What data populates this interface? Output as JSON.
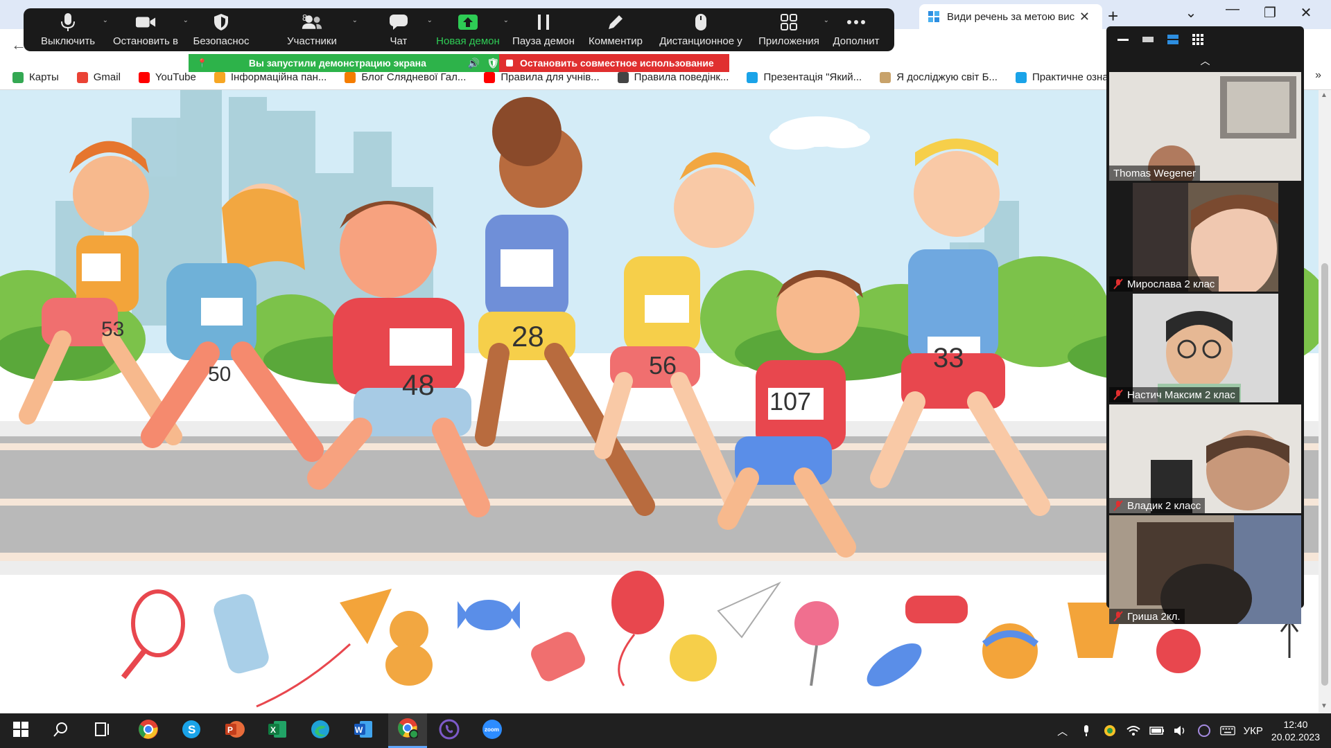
{
  "browser": {
    "tabs": [
      {
        "title": "Види речень за метою вис"
      }
    ],
    "bookmarks": [
      {
        "label": "Карты",
        "icon": "maps-icon"
      },
      {
        "label": "Gmail",
        "icon": "gmail-icon"
      },
      {
        "label": "YouTube",
        "icon": "youtube-icon"
      },
      {
        "label": "Інформаційна пан...",
        "icon": "folder-icon"
      },
      {
        "label": "Блог Слядневої Гал...",
        "icon": "blogger-icon"
      },
      {
        "label": "Правила для учнів...",
        "icon": "youtube-icon"
      },
      {
        "label": "Правила поведінк...",
        "icon": "doc-icon"
      },
      {
        "label": "Презентація \"Який...",
        "icon": "snowflake-icon"
      },
      {
        "label": "Я досліджую світ Б...",
        "icon": "book-icon"
      },
      {
        "label": "Практичне ознайо",
        "icon": "snowflake-icon"
      }
    ]
  },
  "toolbar": {
    "buttons": [
      {
        "key": "mute",
        "label": "Выключить",
        "icon": "microphone-icon"
      },
      {
        "key": "video",
        "label": "Остановить в",
        "icon": "video-camera-icon"
      },
      {
        "key": "security",
        "label": "Безопаснос",
        "icon": "shield-icon"
      },
      {
        "key": "participants",
        "label": "Участники",
        "icon": "participants-icon",
        "count": "8"
      },
      {
        "key": "chat",
        "label": "Чат",
        "icon": "chat-icon"
      },
      {
        "key": "share",
        "label": "Новая демон",
        "icon": "share-screen-icon"
      },
      {
        "key": "pause",
        "label": "Пауза демон",
        "icon": "pause-icon"
      },
      {
        "key": "annotate",
        "label": "Комментир",
        "icon": "pencil-icon"
      },
      {
        "key": "remote",
        "label": "Дистанционное у",
        "icon": "mouse-icon"
      },
      {
        "key": "apps",
        "label": "Приложения",
        "icon": "apps-icon"
      },
      {
        "key": "more",
        "label": "Дополнит",
        "icon": "more-icon"
      }
    ]
  },
  "share_banner": {
    "status": "Вы запустили демонстрацию экрана",
    "stop": "Остановить совместное использование"
  },
  "participants": [
    {
      "name": "Thomas Wegener",
      "muted": false
    },
    {
      "name": "Мирослава 2 клас",
      "muted": true
    },
    {
      "name": "Настич Максим 2 клас",
      "muted": true
    },
    {
      "name": "Владик 2 класс",
      "muted": true
    },
    {
      "name": "Гриша 2кл.",
      "muted": true
    }
  ],
  "slide": {
    "bibs": [
      "53",
      "50",
      "48",
      "28",
      "56",
      "107",
      "33"
    ]
  },
  "taskbar": {
    "apps": [
      "start",
      "search",
      "task-view",
      "chrome",
      "skype",
      "powerpoint",
      "excel",
      "edge",
      "word",
      "chrome-profile",
      "viber",
      "zoom"
    ],
    "language": "УКР",
    "time": "12:40",
    "date": "20.02.2023"
  },
  "colors": {
    "toolbar_bg": "#1a1a1a",
    "share_green": "#2db34a",
    "stop_red": "#e02f2f",
    "sky": "#d4ecf7",
    "road": "#b9b9b9"
  }
}
